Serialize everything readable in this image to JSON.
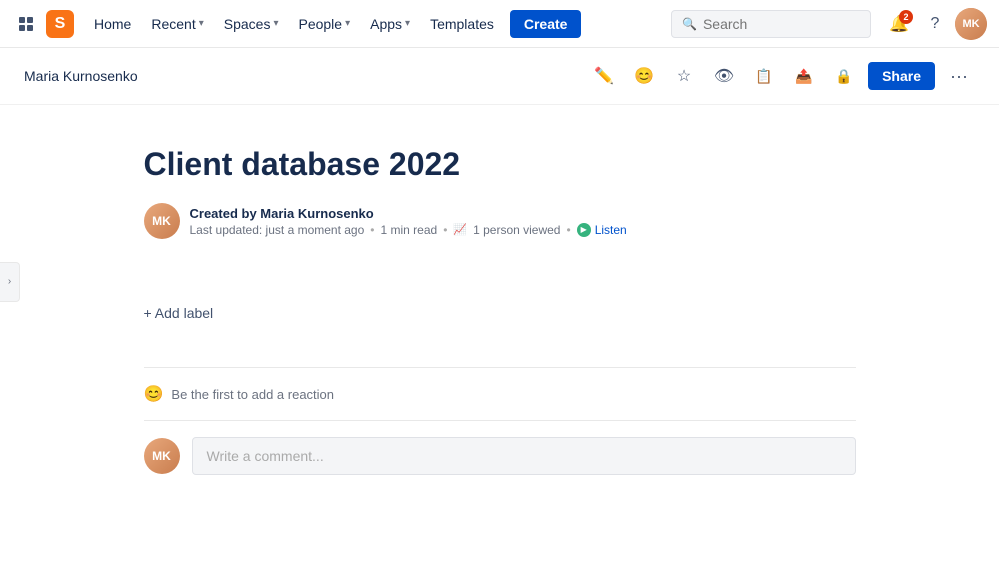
{
  "app": {
    "logo_letter": "S",
    "grid_icon": "grid-icon"
  },
  "nav": {
    "home": "Home",
    "recent": "Recent",
    "spaces": "Spaces",
    "people": "People",
    "apps": "Apps",
    "templates": "Templates",
    "create": "Create",
    "search_placeholder": "Search",
    "notification_count": "2",
    "avatar_initials": "MK"
  },
  "toolbar": {
    "breadcrumb": "Maria Kurnosenko",
    "share_label": "Share",
    "more_icon": "•••"
  },
  "page": {
    "title": "Client database 2022",
    "author_name": "Created by Maria Kurnosenko",
    "last_updated": "Last updated: just a moment ago",
    "read_time": "1 min read",
    "view_count": "1 person viewed",
    "listen_label": "Listen",
    "add_label": "+ Add label",
    "reaction_label": "Be the first to add a reaction",
    "comment_placeholder": "Write a comment...",
    "avatar_initials": "MK"
  }
}
